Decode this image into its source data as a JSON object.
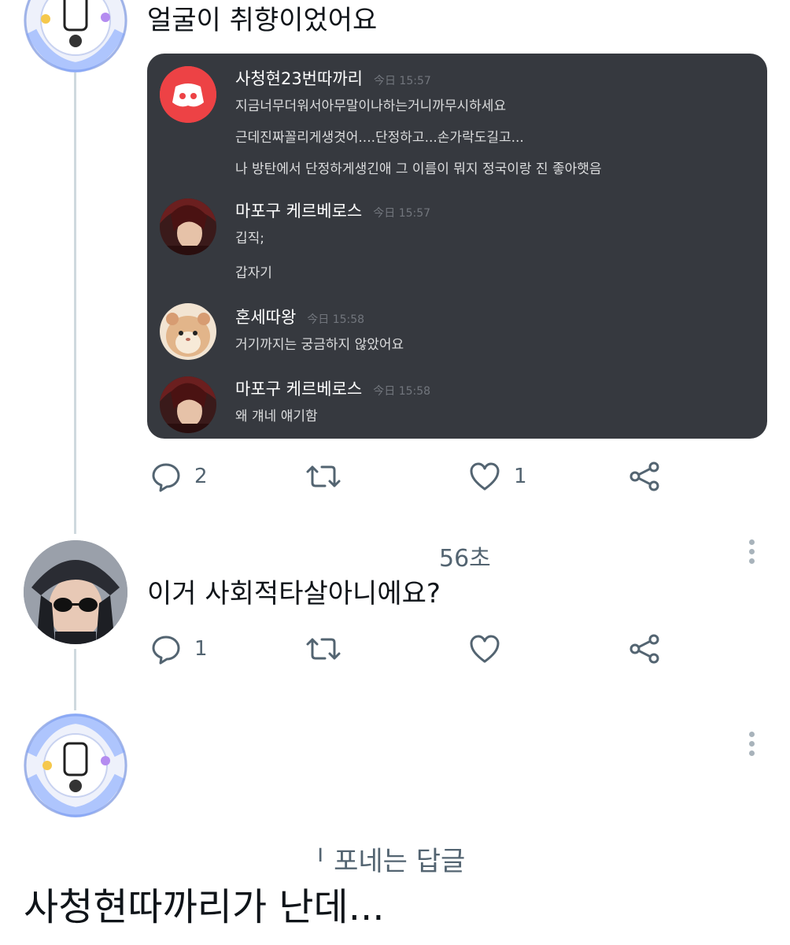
{
  "tweet1": {
    "text": "얼굴이 취향이었어요",
    "avatar_icon": "circular-sticker-avatar-icon",
    "discord": {
      "bg": "#36393f",
      "messages": [
        {
          "username": "사청현23번따까리",
          "time": "今日 15:57",
          "avatar_icon": "discord-logo-icon",
          "lines": [
            "지금너무더워서아무말이나하는거니까무시하세요",
            "근데진짜꼴리게생겻어....단정하고...손가락도길고...",
            "나 방탄에서 단정하게생긴애 그 이름이 뭐지 정국이랑 진 좋아햇음"
          ]
        },
        {
          "username": "마포구 케르베로스",
          "time": "今日 15:57",
          "avatar_icon": "anime-character-avatar-icon",
          "lines": [
            "깁직;",
            "갑자기"
          ]
        },
        {
          "username": "혼세따왕",
          "time": "今日 15:58",
          "avatar_icon": "hamster-avatar-icon",
          "lines": [
            "거기까지는 궁금하지 않았어요"
          ]
        },
        {
          "username": "마포구 케르베로스",
          "time": "今日 15:58",
          "avatar_icon": "anime-character-avatar-icon",
          "lines": [
            "왜 걔네 얘기함"
          ]
        }
      ]
    },
    "actions": {
      "reply_count": "2",
      "retweet_count": "",
      "like_count": "1"
    }
  },
  "tweet2": {
    "time": "56초",
    "text": "이거 사회적타살아니에요?",
    "avatar_icon": "anime-character-sunglasses-avatar-icon",
    "actions": {
      "reply_count": "1",
      "retweet_count": "",
      "like_count": ""
    }
  },
  "tweet3": {
    "avatar_icon": "circular-sticker-avatar-icon",
    "overlay_text": "ᅵ 포네는 답글",
    "bottom_text": "사청현따까리가 난데..."
  },
  "colors": {
    "accent_gray": "#536471",
    "discord_red": "#ed4245",
    "thread_line": "#cfd9de"
  }
}
